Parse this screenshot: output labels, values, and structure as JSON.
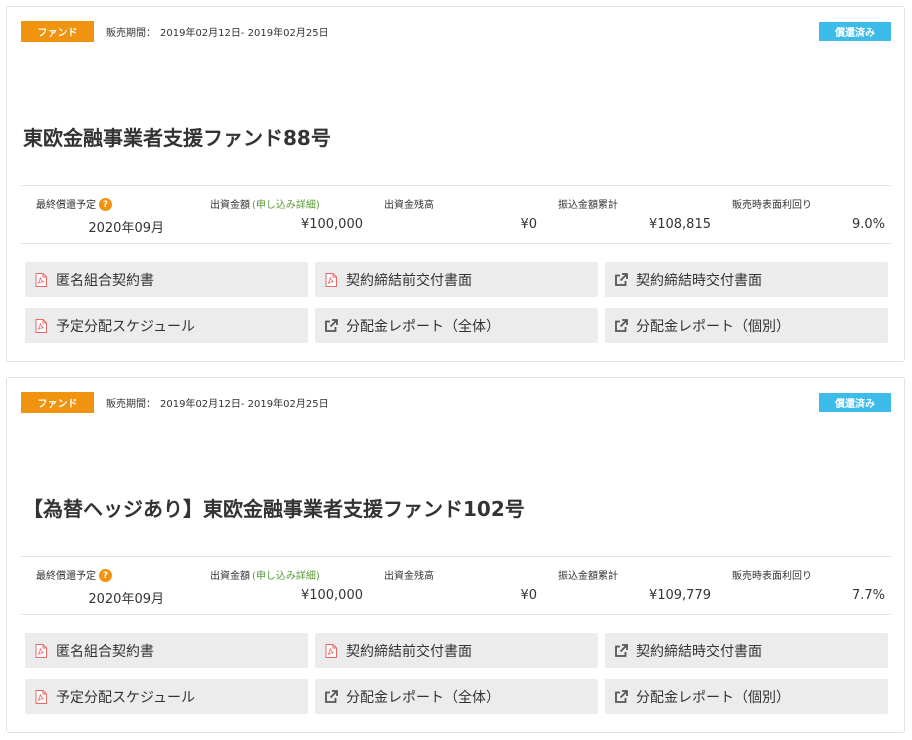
{
  "colors": {
    "fund_badge": "#f0930f",
    "status_badge": "#3dbce9",
    "detail_link": "#5a9a3a",
    "button_bg": "#ececec"
  },
  "funds": [
    {
      "badge": "ファンド",
      "period_label": "販売期間：",
      "period_value": "2019年02月12日- 2019年02月25日",
      "status": "償還済み",
      "title": "東欧金融事業者支援ファンド88号",
      "stats": [
        {
          "label": "最終償還予定",
          "value": "2020年09月",
          "help_icon": "question-icon"
        },
        {
          "label": "出資金額",
          "detail": "(申し込み詳細)",
          "value": "¥100,000"
        },
        {
          "label": "出資金残高",
          "value": "¥0"
        },
        {
          "label": "振込金額累計",
          "value": "¥108,815"
        },
        {
          "label": "販売時表面利回り",
          "value": "9.0%"
        }
      ],
      "documents": [
        {
          "label": "匿名組合契約書",
          "icon": "pdf-icon"
        },
        {
          "label": "契約締結前交付書面",
          "icon": "pdf-icon"
        },
        {
          "label": "契約締結時交付書面",
          "icon": "external-link-icon"
        },
        {
          "label": "予定分配スケジュール",
          "icon": "pdf-icon"
        },
        {
          "label": "分配金レポート（全体）",
          "icon": "external-link-icon"
        },
        {
          "label": "分配金レポート（個別）",
          "icon": "external-link-icon"
        }
      ]
    },
    {
      "badge": "ファンド",
      "period_label": "販売期間：",
      "period_value": "2019年02月12日- 2019年02月25日",
      "status": "償還済み",
      "title": "【為替ヘッジあり】東欧金融事業者支援ファンド102号",
      "stats": [
        {
          "label": "最終償還予定",
          "value": "2020年09月",
          "help_icon": "question-icon"
        },
        {
          "label": "出資金額",
          "detail": "(申し込み詳細)",
          "value": "¥100,000"
        },
        {
          "label": "出資金残高",
          "value": "¥0"
        },
        {
          "label": "振込金額累計",
          "value": "¥109,779"
        },
        {
          "label": "販売時表面利回り",
          "value": "7.7%"
        }
      ],
      "documents": [
        {
          "label": "匿名組合契約書",
          "icon": "pdf-icon"
        },
        {
          "label": "契約締結前交付書面",
          "icon": "pdf-icon"
        },
        {
          "label": "契約締結時交付書面",
          "icon": "external-link-icon"
        },
        {
          "label": "予定分配スケジュール",
          "icon": "pdf-icon"
        },
        {
          "label": "分配金レポート（全体）",
          "icon": "external-link-icon"
        },
        {
          "label": "分配金レポート（個別）",
          "icon": "external-link-icon"
        }
      ]
    }
  ]
}
